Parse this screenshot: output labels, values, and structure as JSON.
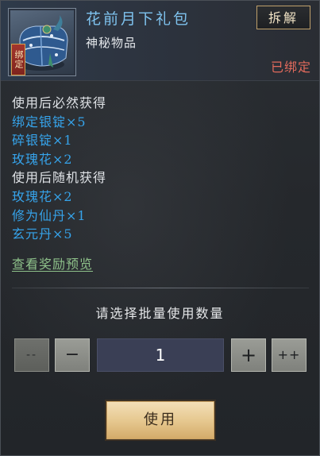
{
  "item": {
    "name": "花前月下礼包",
    "type": "神秘物品",
    "bound_tag": "绑定",
    "bound_status": "已绑定",
    "icon": "blue-gift-bundle-icon"
  },
  "header": {
    "dismantle_label": "拆解"
  },
  "description": [
    {
      "text": "使用后必然获得",
      "style": "plain"
    },
    {
      "text": "绑定银锭×5",
      "style": "blue"
    },
    {
      "text": "碎银锭×1",
      "style": "blue"
    },
    {
      "text": "玫瑰花×2",
      "style": "blue"
    },
    {
      "text": "使用后随机获得",
      "style": "plain"
    },
    {
      "text": "玫瑰花×2",
      "style": "blue"
    },
    {
      "text": "修为仙丹×1",
      "style": "blue"
    },
    {
      "text": "玄元丹×5",
      "style": "blue"
    }
  ],
  "preview_link": "查看奖励预览",
  "quantity": {
    "prompt": "请选择批量使用数量",
    "value": "1",
    "decrease_many_label": "--",
    "decrease_label": "−",
    "increase_label": "+",
    "increase_many_label": "++"
  },
  "use_button_label": "使用",
  "colors": {
    "name_blue": "#7ec2ee",
    "reward_blue": "#36a3ea",
    "bound_red": "#e26a5c",
    "link_green": "#8ec18a",
    "button_gold": "#e5c68d"
  }
}
